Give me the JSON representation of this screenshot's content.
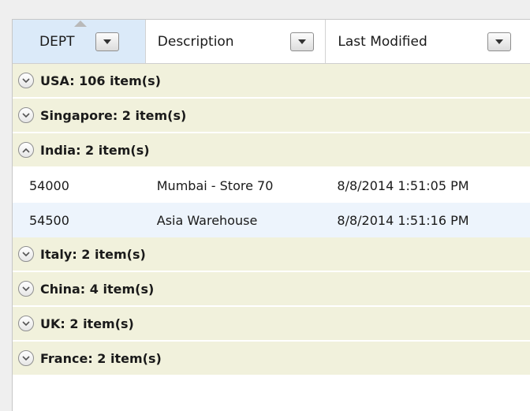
{
  "columns": [
    {
      "label": "DEPT"
    },
    {
      "label": "Description"
    },
    {
      "label": "Last Modified"
    }
  ],
  "groups": [
    {
      "label": "USA: 106 item(s)",
      "expanded": false
    },
    {
      "label": "Singapore: 2 item(s)",
      "expanded": false
    },
    {
      "label": "India: 2 item(s)",
      "expanded": true,
      "rows": [
        {
          "dept": "54000",
          "description": "Mumbai - Store 70",
          "modified": "8/8/2014 1:51:05 PM"
        },
        {
          "dept": "54500",
          "description": "Asia Warehouse",
          "modified": "8/8/2014 1:51:16 PM"
        }
      ]
    },
    {
      "label": "Italy: 2 item(s)",
      "expanded": false
    },
    {
      "label": "China: 4 item(s)",
      "expanded": false
    },
    {
      "label": "UK: 2 item(s)",
      "expanded": false
    },
    {
      "label": "France: 2 item(s)",
      "expanded": false
    }
  ],
  "colors": {
    "group_background": "#f1f1dc",
    "sorted_header": "#dbeaf9",
    "alt_row": "#edf4fc"
  },
  "icons": {
    "sort": "sort-ascending-arrow",
    "filter": "chevron-down-icon",
    "collapsed": "expand-chevron-down-icon",
    "expanded": "collapse-chevron-up-icon"
  }
}
